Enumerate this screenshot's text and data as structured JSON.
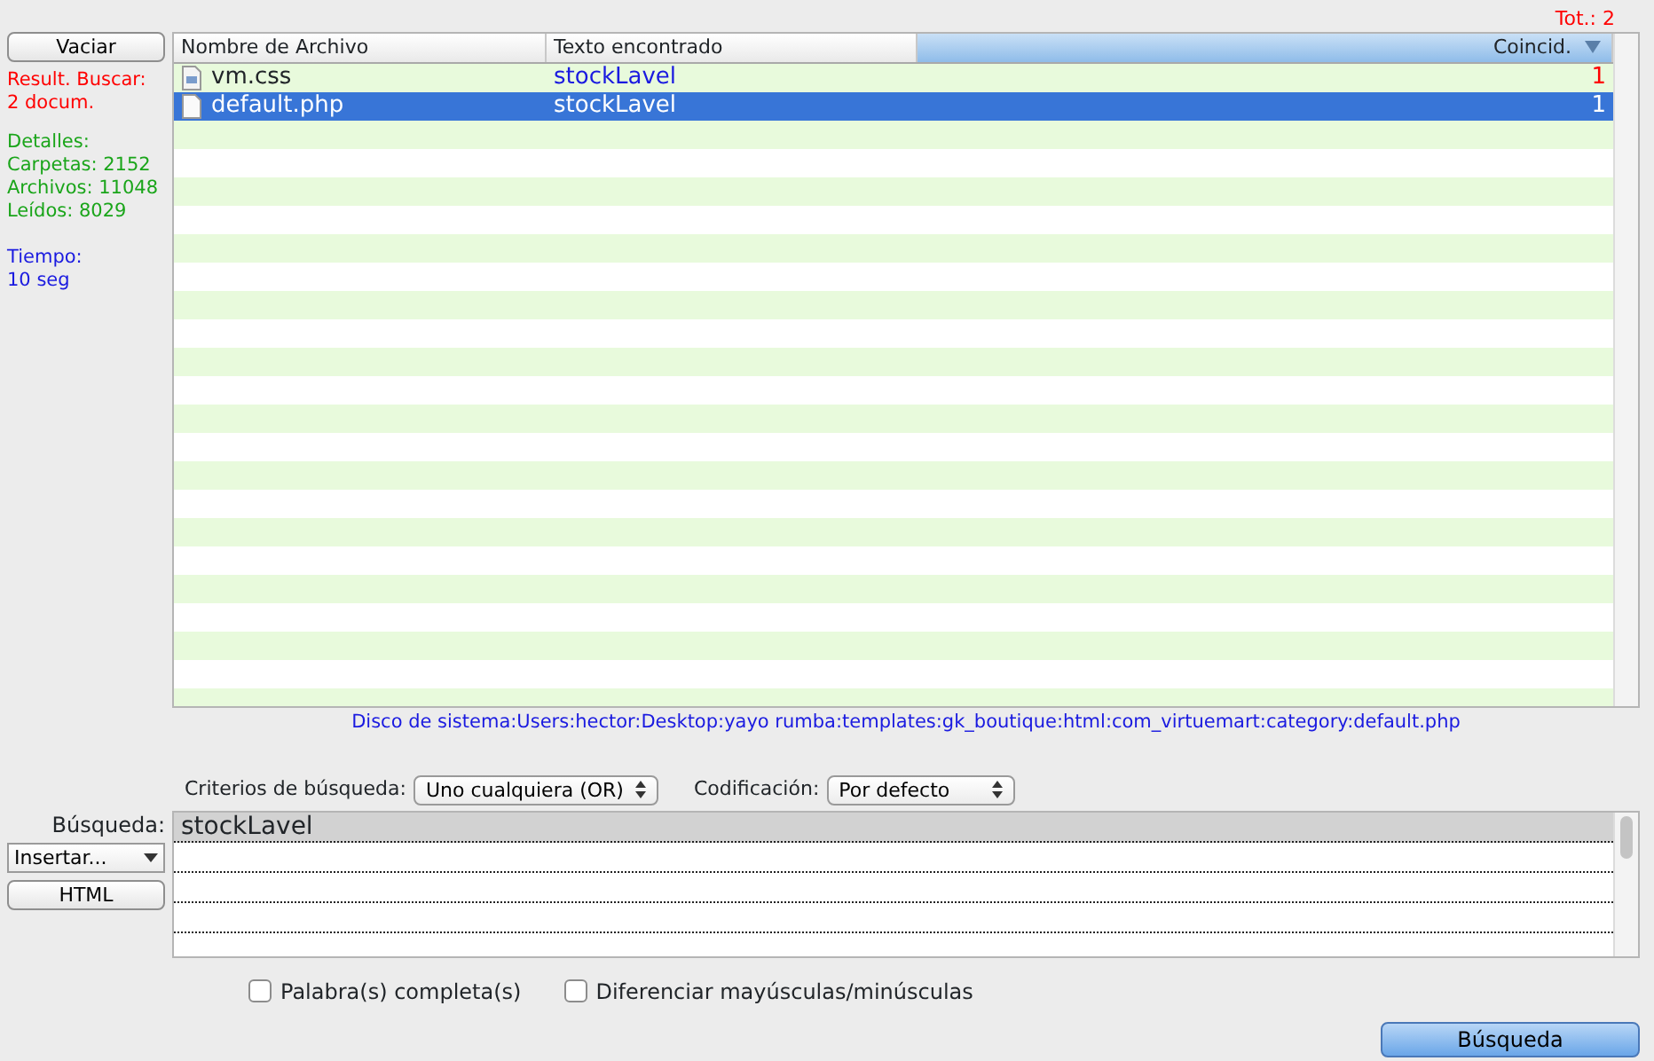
{
  "total": "Tot.: 2",
  "left_panel": {
    "clear_button": "Vaciar",
    "result_lines": [
      "Result. Buscar:",
      "2 docum."
    ],
    "details": [
      "Detalles:",
      "Carpetas: 2152",
      "Archivos: 11048",
      "Leídos: 8029"
    ],
    "time": [
      "Tiempo:",
      "10 seg"
    ]
  },
  "table": {
    "columns": [
      {
        "label": "Nombre de Archivo",
        "sorted": false
      },
      {
        "label": "Texto encontrado",
        "sorted": false
      },
      {
        "label": "Coincid.",
        "sorted": true
      }
    ],
    "rows": [
      {
        "file": "vm.css",
        "kind": "css",
        "text": "stockLavel",
        "matches": "1",
        "selected": false
      },
      {
        "file": "default.php",
        "kind": "php",
        "text": "stockLavel",
        "matches": "1",
        "selected": true
      }
    ]
  },
  "path": "Disco de sistema:Users:hector:Desktop:yayo rumba:templates:gk_boutique:html:com_virtuemart:category:default.php",
  "criteria": {
    "label": "Criterios de búsqueda:",
    "value": "Uno cualquiera (OR)"
  },
  "encoding": {
    "label": "Codificación:",
    "value": "Por defecto"
  },
  "search": {
    "label": "Búsqueda:",
    "insert": "Insertar...",
    "html_button": "HTML",
    "lines": [
      "stockLavel"
    ]
  },
  "options": [
    {
      "label": "Palabra(s) completa(s)",
      "checked": false
    },
    {
      "label": "Diferenciar mayúsculas/minúsculas",
      "checked": false
    }
  ],
  "search_button": "Búsqueda"
}
